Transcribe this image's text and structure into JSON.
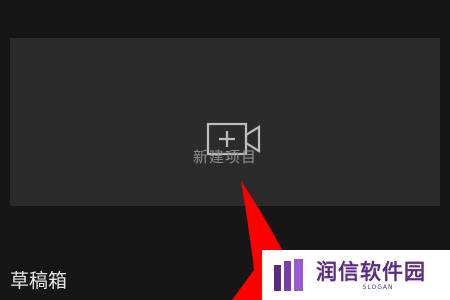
{
  "main": {
    "new_project": {
      "icon": "video-camera-plus-icon",
      "label": "新建项目"
    },
    "drafts": {
      "title": "草稿箱"
    }
  },
  "overlay": {
    "arrow_color": "#ff0000"
  },
  "watermark": {
    "name": "润信软件园",
    "slogan": "SLOGAN",
    "color": "#5b2a86"
  }
}
